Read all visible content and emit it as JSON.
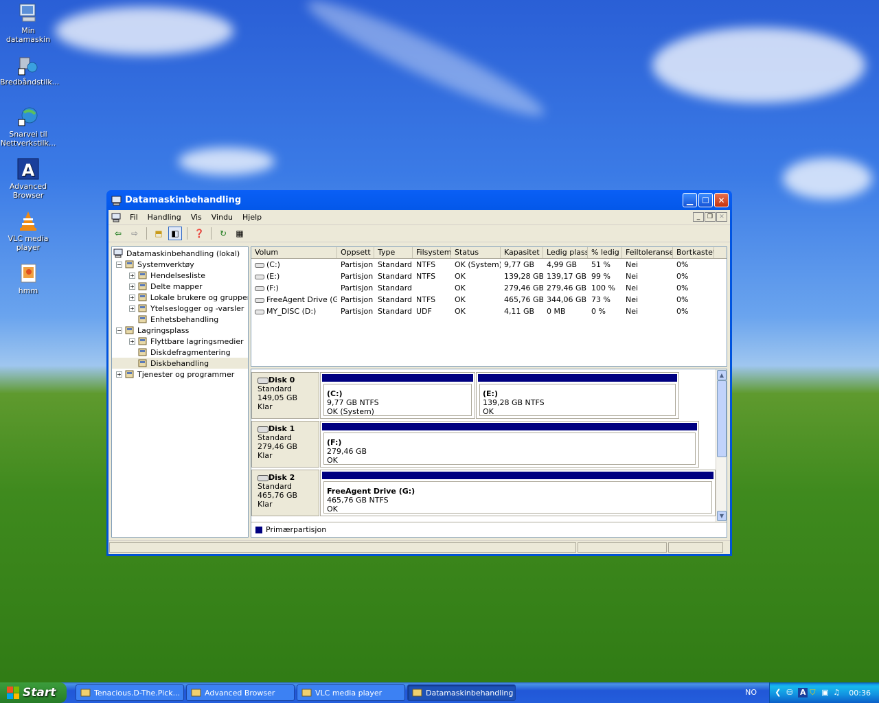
{
  "desktop": {
    "icons": [
      {
        "label": "Min datamaskin",
        "icon": "my-computer-icon"
      },
      {
        "label": "Bredbåndstilk...",
        "icon": "network-connection-icon"
      },
      {
        "label": "Snarvei til Nettverkstilk...",
        "icon": "network-shortcut-icon"
      },
      {
        "label": "Advanced Browser",
        "icon": "advanced-browser-icon"
      },
      {
        "label": "VLC media player",
        "icon": "vlc-cone-icon"
      },
      {
        "label": "hmm",
        "icon": "image-file-icon"
      }
    ]
  },
  "window": {
    "title": "Datamaskinbehandling",
    "menu": [
      "Fil",
      "Handling",
      "Vis",
      "Vindu",
      "Hjelp"
    ],
    "tree": {
      "root": "Datamaskinbehandling (lokal)",
      "items": [
        {
          "label": "Systemverktøy",
          "level": 1,
          "expander": "−"
        },
        {
          "label": "Hendelsesliste",
          "level": 2,
          "expander": "+"
        },
        {
          "label": "Delte mapper",
          "level": 2,
          "expander": "+"
        },
        {
          "label": "Lokale brukere og grupper",
          "level": 2,
          "expander": "+"
        },
        {
          "label": "Ytelseslogger og -varsler",
          "level": 2,
          "expander": "+"
        },
        {
          "label": "Enhetsbehandling",
          "level": 2,
          "expander": ""
        },
        {
          "label": "Lagringsplass",
          "level": 1,
          "expander": "−"
        },
        {
          "label": "Flyttbare lagringsmedier",
          "level": 2,
          "expander": "+"
        },
        {
          "label": "Diskdefragmentering",
          "level": 2,
          "expander": ""
        },
        {
          "label": "Diskbehandling",
          "level": 2,
          "expander": ""
        },
        {
          "label": "Tjenester og programmer",
          "level": 1,
          "expander": "+"
        }
      ]
    },
    "volumes": {
      "columns": [
        "Volum",
        "Oppsett",
        "Type",
        "Filsystem",
        "Status",
        "Kapasitet",
        "Ledig plass",
        "% ledig",
        "Feiltoleranse",
        "Bortkastet"
      ],
      "rows": [
        [
          "(C:)",
          "Partisjon",
          "Standard",
          "NTFS",
          "OK (System)",
          "9,77 GB",
          "4,99 GB",
          "51 %",
          "Nei",
          "0%"
        ],
        [
          "(E:)",
          "Partisjon",
          "Standard",
          "NTFS",
          "OK",
          "139,28 GB",
          "139,17 GB",
          "99 %",
          "Nei",
          "0%"
        ],
        [
          "(F:)",
          "Partisjon",
          "Standard",
          "",
          "OK",
          "279,46 GB",
          "279,46 GB",
          "100 %",
          "Nei",
          "0%"
        ],
        [
          "FreeAgent Drive (G:)",
          "Partisjon",
          "Standard",
          "NTFS",
          "OK",
          "465,76 GB",
          "344,06 GB",
          "73 %",
          "Nei",
          "0%"
        ],
        [
          "MY_DISC (D:)",
          "Partisjon",
          "Standard",
          "UDF",
          "OK",
          "4,11 GB",
          "0 MB",
          "0 %",
          "Nei",
          "0%"
        ]
      ]
    },
    "disks": [
      {
        "name": "Disk 0",
        "type": "Standard",
        "size": "149,05 GB",
        "state": "Klar",
        "partitions": [
          {
            "name": "(C:)",
            "size": "9,77 GB NTFS",
            "status": "OK (System)"
          },
          {
            "name": "(E:)",
            "size": "139,28 GB NTFS",
            "status": "OK"
          }
        ]
      },
      {
        "name": "Disk 1",
        "type": "Standard",
        "size": "279,46 GB",
        "state": "Klar",
        "partitions": [
          {
            "name": "(F:)",
            "size": "279,46 GB",
            "status": "OK"
          }
        ]
      },
      {
        "name": "Disk 2",
        "type": "Standard",
        "size": "465,76 GB",
        "state": "Klar",
        "partitions": [
          {
            "name": "FreeAgent Drive  (G:)",
            "size": "465,76 GB NTFS",
            "status": "OK"
          }
        ]
      }
    ],
    "legend": "Primærpartisjon",
    "legend_color": "#000080"
  },
  "taskbar": {
    "start": "Start",
    "buttons": [
      {
        "label": "Tenacious.D-The.Pick...",
        "icon": "folder-icon"
      },
      {
        "label": "Advanced Browser",
        "icon": "advanced-browser-icon"
      },
      {
        "label": "VLC media player",
        "icon": "vlc-cone-icon"
      },
      {
        "label": "Datamaskinbehandling",
        "icon": "computer-management-icon"
      }
    ],
    "language": "NO",
    "clock": "00:36"
  }
}
